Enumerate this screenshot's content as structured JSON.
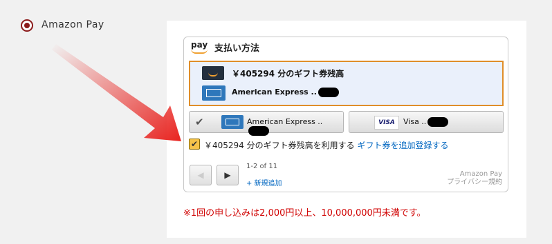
{
  "option": {
    "label": "Amazon Pay"
  },
  "widget": {
    "logo": "pay",
    "title": "支払い方法",
    "selected": {
      "gift_text": "￥405294 分のギフト券残高",
      "card_text": "American Express .."
    },
    "cards": [
      {
        "label": "American Express ..",
        "icon": "amex-card-icon"
      },
      {
        "label": "Visa ..",
        "icon": "visa-card-icon",
        "brand_text": "VISA"
      }
    ],
    "checkbox": {
      "text": "￥405294 分のギフト券残高を利用する",
      "link": "ギフト券を追加登録する",
      "checked": true
    },
    "pagination": {
      "count": "1-2 of 11",
      "add_new": "+ 新規追加"
    },
    "brand": {
      "line1": "Amazon Pay",
      "line2": "プライバシー規約"
    }
  },
  "notice": "※1回の申し込みは2,000円以上、10,000,000円未満です。",
  "colors": {
    "accent": "#e08e2a",
    "notice": "#d00000",
    "link": "#0066c0",
    "radio": "#8b1a1a",
    "arrow": "#e8231f"
  }
}
